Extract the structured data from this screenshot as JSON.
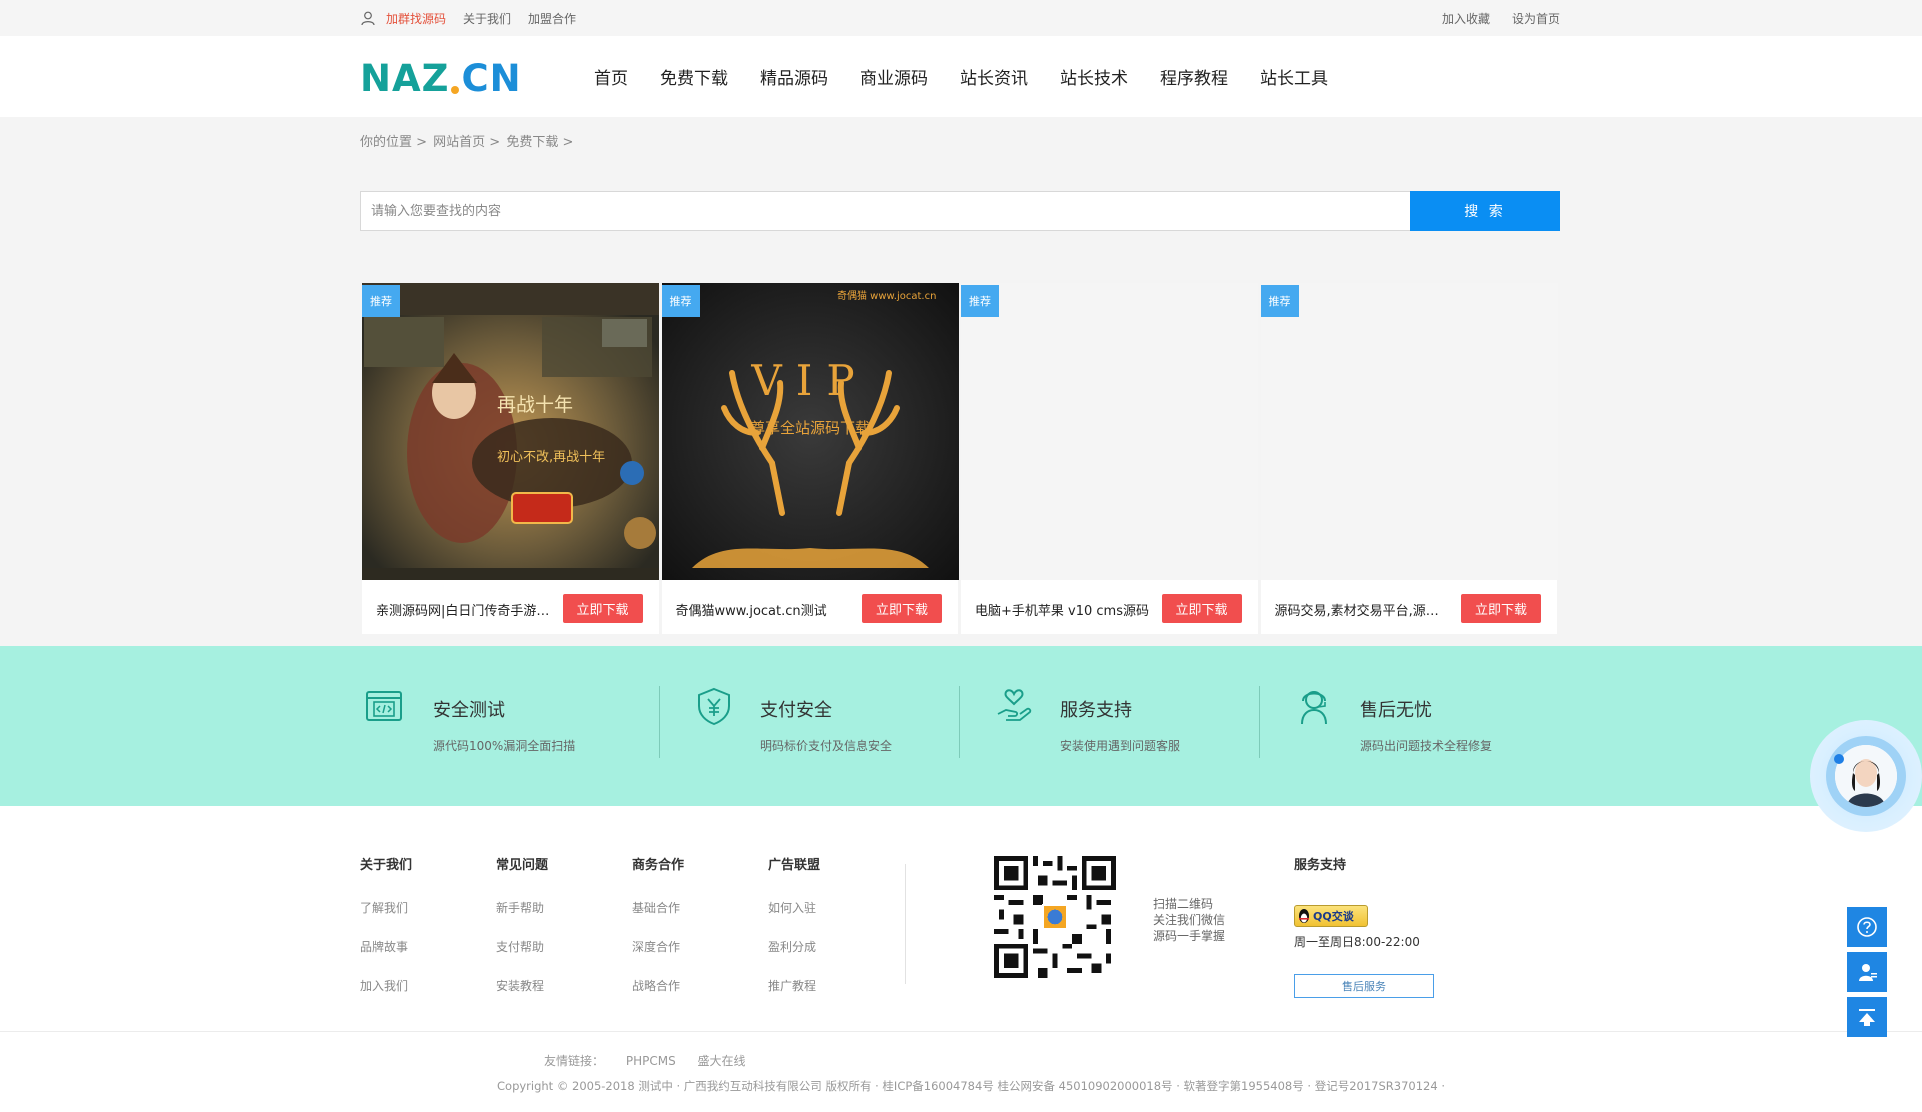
{
  "topbar": {
    "user_icon": "user-icon",
    "links": [
      "加群找源码",
      "关于我们",
      "加盟合作"
    ],
    "right_links": [
      "加入收藏",
      "设为首页"
    ],
    "highlight_color": "#e4513b"
  },
  "header": {
    "logo": {
      "part1": "NAZ",
      "dot": ".",
      "part2": "CN"
    },
    "nav": [
      "首页",
      "免费下载",
      "精品源码",
      "商业源码",
      "站长资讯",
      "站长技术",
      "程序教程",
      "站长工具"
    ]
  },
  "breadcrumb": [
    "你的位置 >",
    "网站首页 >",
    "免费下载 >"
  ],
  "search": {
    "placeholder": "请输入您要查找的内容",
    "button": "搜 索",
    "button_color": "#0a8ef3"
  },
  "cards": [
    {
      "badge": "推荐",
      "title": "亲测源码网|白日门传奇手游源码",
      "button": "立即下载",
      "thumb": "game-screenshot"
    },
    {
      "badge": "推荐",
      "title": "奇偶猫www.jocat.cn测试",
      "button": "立即下载",
      "thumb": "vip-banner",
      "thumb_text": "VIP",
      "thumb_sub": "尊享全站源码下载",
      "thumb_corner": "奇偶猫 www.jocat.cn"
    },
    {
      "badge": "推荐",
      "title": "电脑+手机苹果 v10 cms源码",
      "button": "立即下载",
      "thumb": "blank"
    },
    {
      "badge": "推荐",
      "title": "源码交易,素材交易平台,源码下载",
      "button": "立即下载",
      "thumb": "blank"
    }
  ],
  "card_game_texts": {
    "t1": "再战十年",
    "t2": "初心不改,再战十年"
  },
  "features": [
    {
      "icon": "code-window-icon",
      "title": "安全测试",
      "subtitle": "源代码100%漏洞全面扫描"
    },
    {
      "icon": "yen-shield-icon",
      "title": "支付安全",
      "subtitle": "明码标价支付及信息安全"
    },
    {
      "icon": "heart-hand-icon",
      "title": "服务支持",
      "subtitle": "安装使用遇到问题客服"
    },
    {
      "icon": "headset-agent-icon",
      "title": "售后无忧",
      "subtitle": "源码出问题技术全程修复"
    }
  ],
  "footer": {
    "columns": [
      {
        "title": "关于我们",
        "links": [
          "了解我们",
          "品牌故事",
          "加入我们"
        ]
      },
      {
        "title": "常见问题",
        "links": [
          "新手帮助",
          "支付帮助",
          "安装教程"
        ]
      },
      {
        "title": "商务合作",
        "links": [
          "基础合作",
          "深度合作",
          "战略合作"
        ]
      },
      {
        "title": "广告联盟",
        "links": [
          "如何入驻",
          "盈利分成",
          "推广教程"
        ]
      }
    ],
    "qr_text": [
      "扫描二维码",
      "关注我们微信",
      "源码一手掌握"
    ],
    "service": {
      "title": "服务支持",
      "qq_label": "QQ交谈",
      "hours": "周一至周日8:00-22:00",
      "after_sales": "售后服务"
    },
    "friend_links": [
      "友情链接：",
      "PHPCMS",
      "盛大在线"
    ],
    "copyright": "Copyright © 2005-2018 测试中 · 广西我约互动科技有限公司 版权所有 · 桂ICP备16004784号 桂公网安备 45010902000018号 · 软著登字第1955408号 · 登记号2017SR370124 ·"
  },
  "floating": {
    "avatar": "customer-service-avatar",
    "buttons": [
      "help-icon",
      "contact-icon",
      "back-to-top-icon"
    ]
  },
  "colors": {
    "feature_band": "#a6f0e0",
    "badge": "#45a9f0",
    "download_button": "#f14e4e",
    "accent_blue": "#1f86e3"
  }
}
